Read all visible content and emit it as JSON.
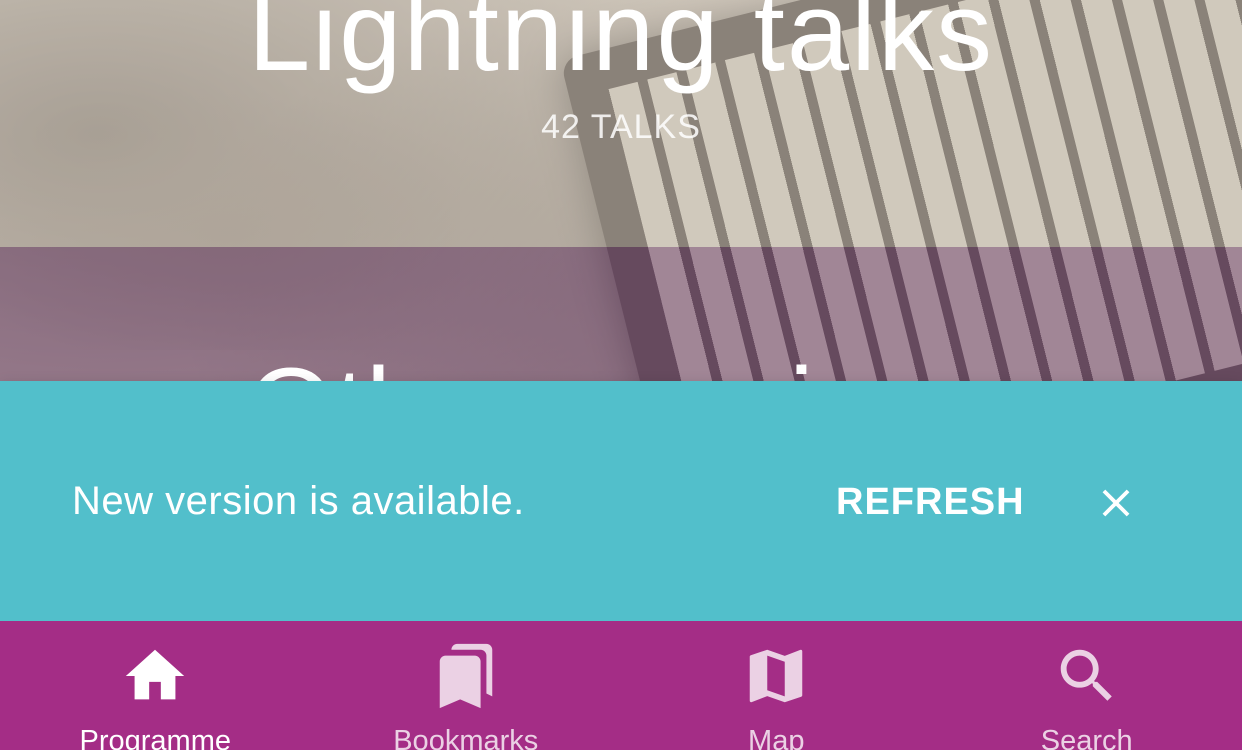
{
  "session_cards": [
    {
      "title": "Lightning talks",
      "count": "42 TALKS"
    },
    {
      "title": "Other sessions"
    }
  ],
  "snackbar": {
    "message": "New version is available.",
    "action_label": "REFRESH",
    "close_icon": "close-icon",
    "background_color": "#52bfcb"
  },
  "bottom_nav": {
    "background_color": "#a42d86",
    "items": [
      {
        "label": "Programme",
        "icon": "home-icon",
        "active": true
      },
      {
        "label": "Bookmarks",
        "icon": "bookmarks-icon",
        "active": false
      },
      {
        "label": "Map",
        "icon": "map-icon",
        "active": false
      },
      {
        "label": "Search",
        "icon": "search-icon",
        "active": false
      }
    ]
  }
}
